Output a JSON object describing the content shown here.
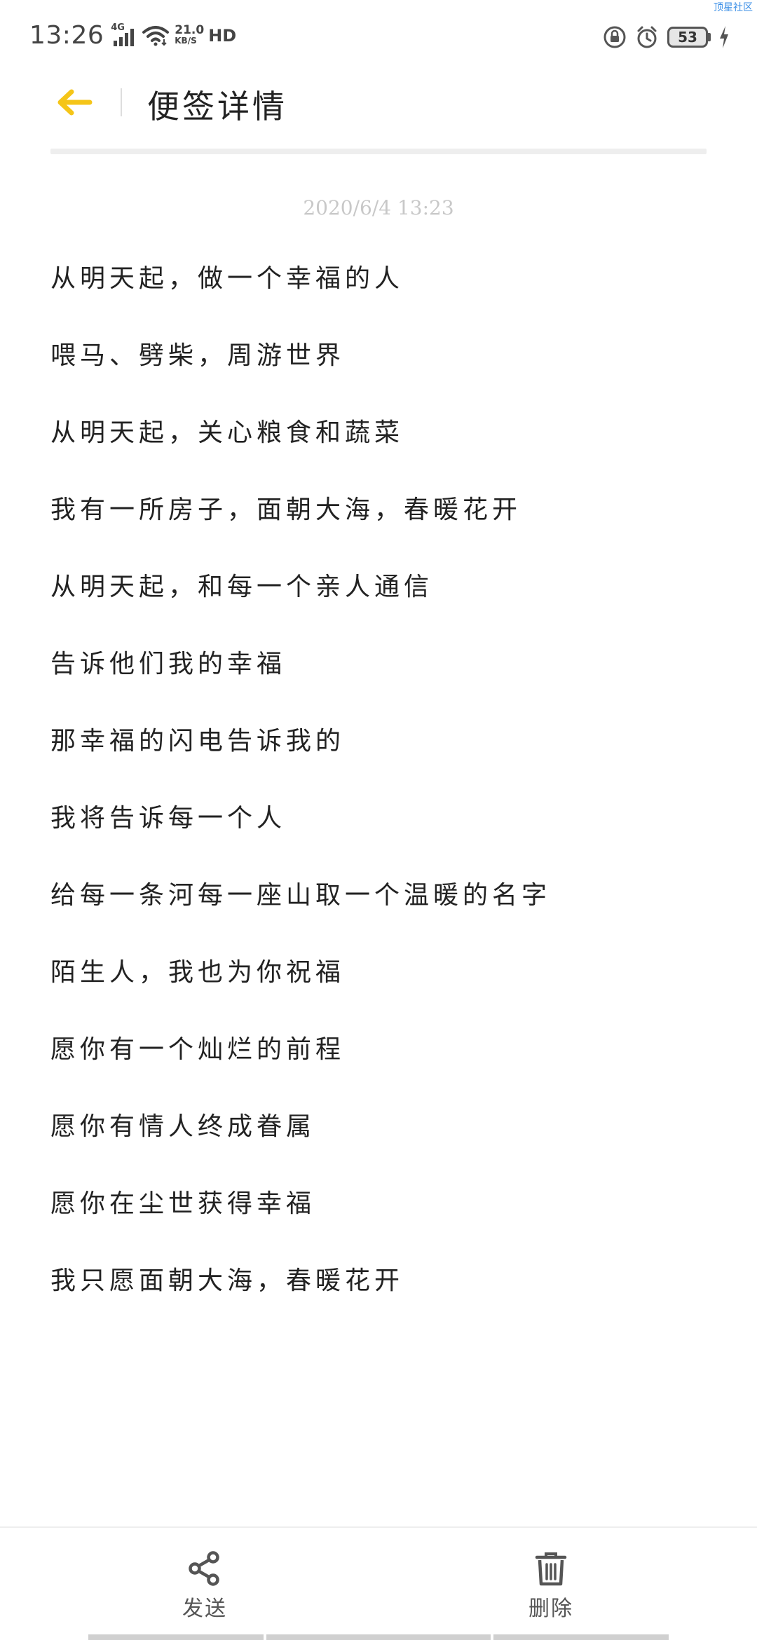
{
  "watermark": "顶星社区",
  "status_bar": {
    "time": "13:26",
    "network_type": "4G",
    "speed_value": "21.0",
    "speed_unit": "KB/S",
    "hd": "HD",
    "battery_level": "53"
  },
  "header": {
    "title": "便签详情",
    "accent_color": "#f5c518"
  },
  "note": {
    "timestamp": "2020/6/4 13:23",
    "lines": [
      "从明天起，做一个幸福的人",
      "喂马、劈柴，周游世界",
      "从明天起，关心粮食和蔬菜",
      "我有一所房子，面朝大海，春暖花开",
      "从明天起，和每一个亲人通信",
      "告诉他们我的幸福",
      "那幸福的闪电告诉我的",
      "我将告诉每一个人",
      "给每一条河每一座山取一个温暖的名字",
      "陌生人，我也为你祝福",
      "愿你有一个灿烂的前程",
      "愿你有情人终成眷属",
      "愿你在尘世获得幸福",
      "我只愿面朝大海，春暖花开"
    ]
  },
  "bottom_bar": {
    "send_label": "发送",
    "send_icon": "share-icon",
    "delete_label": "删除",
    "delete_icon": "trash-icon"
  }
}
